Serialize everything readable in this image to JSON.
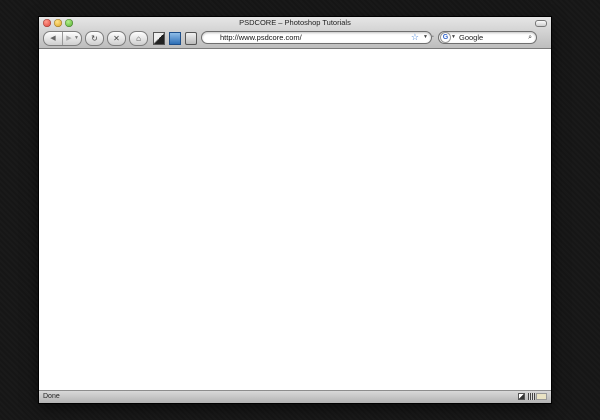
{
  "window": {
    "title": "PSDCORE – Photoshop Tutorials"
  },
  "toolbar": {
    "back_icon": "◀",
    "forward_icon": "▶",
    "nav_dropdown_icon": "▼",
    "reload_icon": "↻",
    "stop_icon": "✕",
    "home_icon": "⌂",
    "address_url": "http://www.psdcore.com/",
    "bookmark_star_icon": "☆",
    "address_dropdown_icon": "▼",
    "search_engine_letter": "G",
    "search_dropdown_icon": "▼",
    "search_value": "Google",
    "search_button_icon": "⌕"
  },
  "statusbar": {
    "status_text": "Done"
  }
}
